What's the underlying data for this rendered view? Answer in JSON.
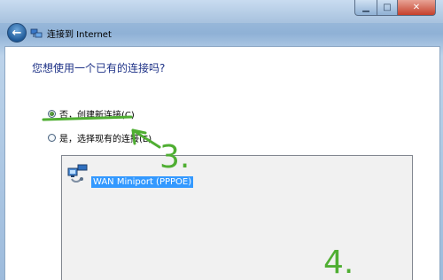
{
  "navbar": {
    "title": "连接到 Internet"
  },
  "question": "您想使用一个已有的连接吗?",
  "options": [
    {
      "label": "否，创建新连接(C)",
      "checked": true
    },
    {
      "label": "是，选择现有的连接(E)",
      "checked": false
    }
  ],
  "connections": [
    {
      "name": "WAN Miniport (PPPOE)",
      "selected": true
    }
  ],
  "annotations": {
    "step3": "3.",
    "step4": "4."
  },
  "colors": {
    "annotation": "#4fae32",
    "selection": "#3399ff",
    "heading": "#1e3287"
  }
}
